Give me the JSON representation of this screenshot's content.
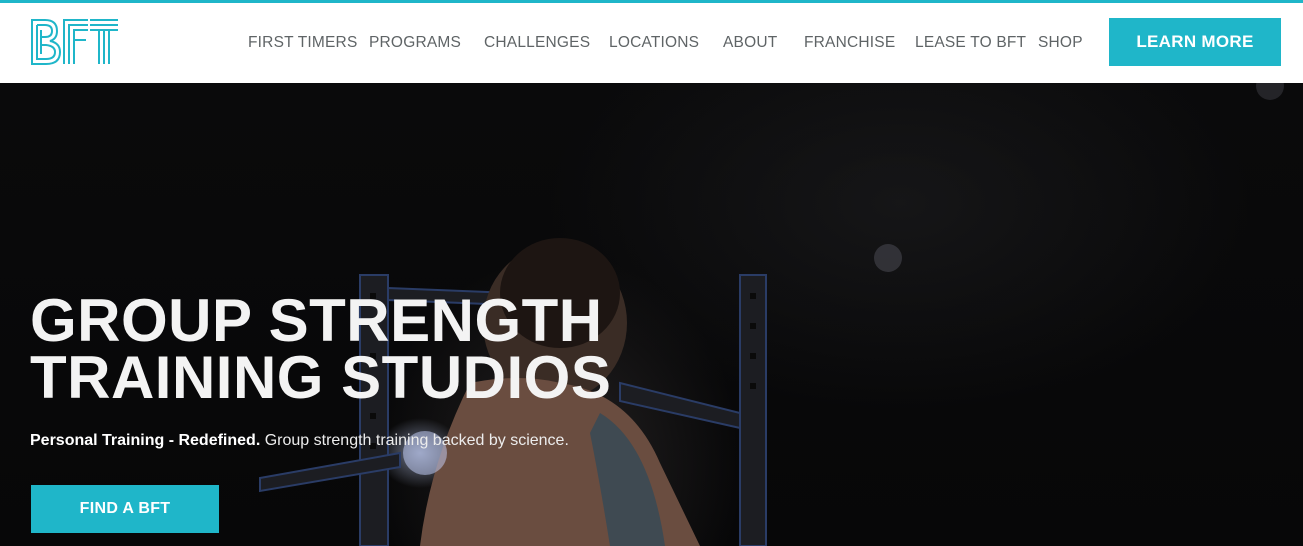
{
  "brand": {
    "logo_text": "BFT",
    "accent_color": "#1fb6c9"
  },
  "nav": {
    "items": [
      {
        "label": "FIRST TIMERS"
      },
      {
        "label": "PROGRAMS"
      },
      {
        "label": "CHALLENGES"
      },
      {
        "label": "LOCATIONS"
      },
      {
        "label": "ABOUT"
      },
      {
        "label": "FRANCHISE"
      },
      {
        "label": "LEASE TO BFT"
      },
      {
        "label": "SHOP"
      }
    ],
    "cta_label": "LEARN MORE"
  },
  "hero": {
    "headline_line1": "GROUP STRENGTH",
    "headline_line2": "TRAINING STUDIOS",
    "sub_bold": "Personal Training - Redefined.",
    "sub_text": " Group strength training backed by science.",
    "button_label": "FIND A BFT"
  }
}
